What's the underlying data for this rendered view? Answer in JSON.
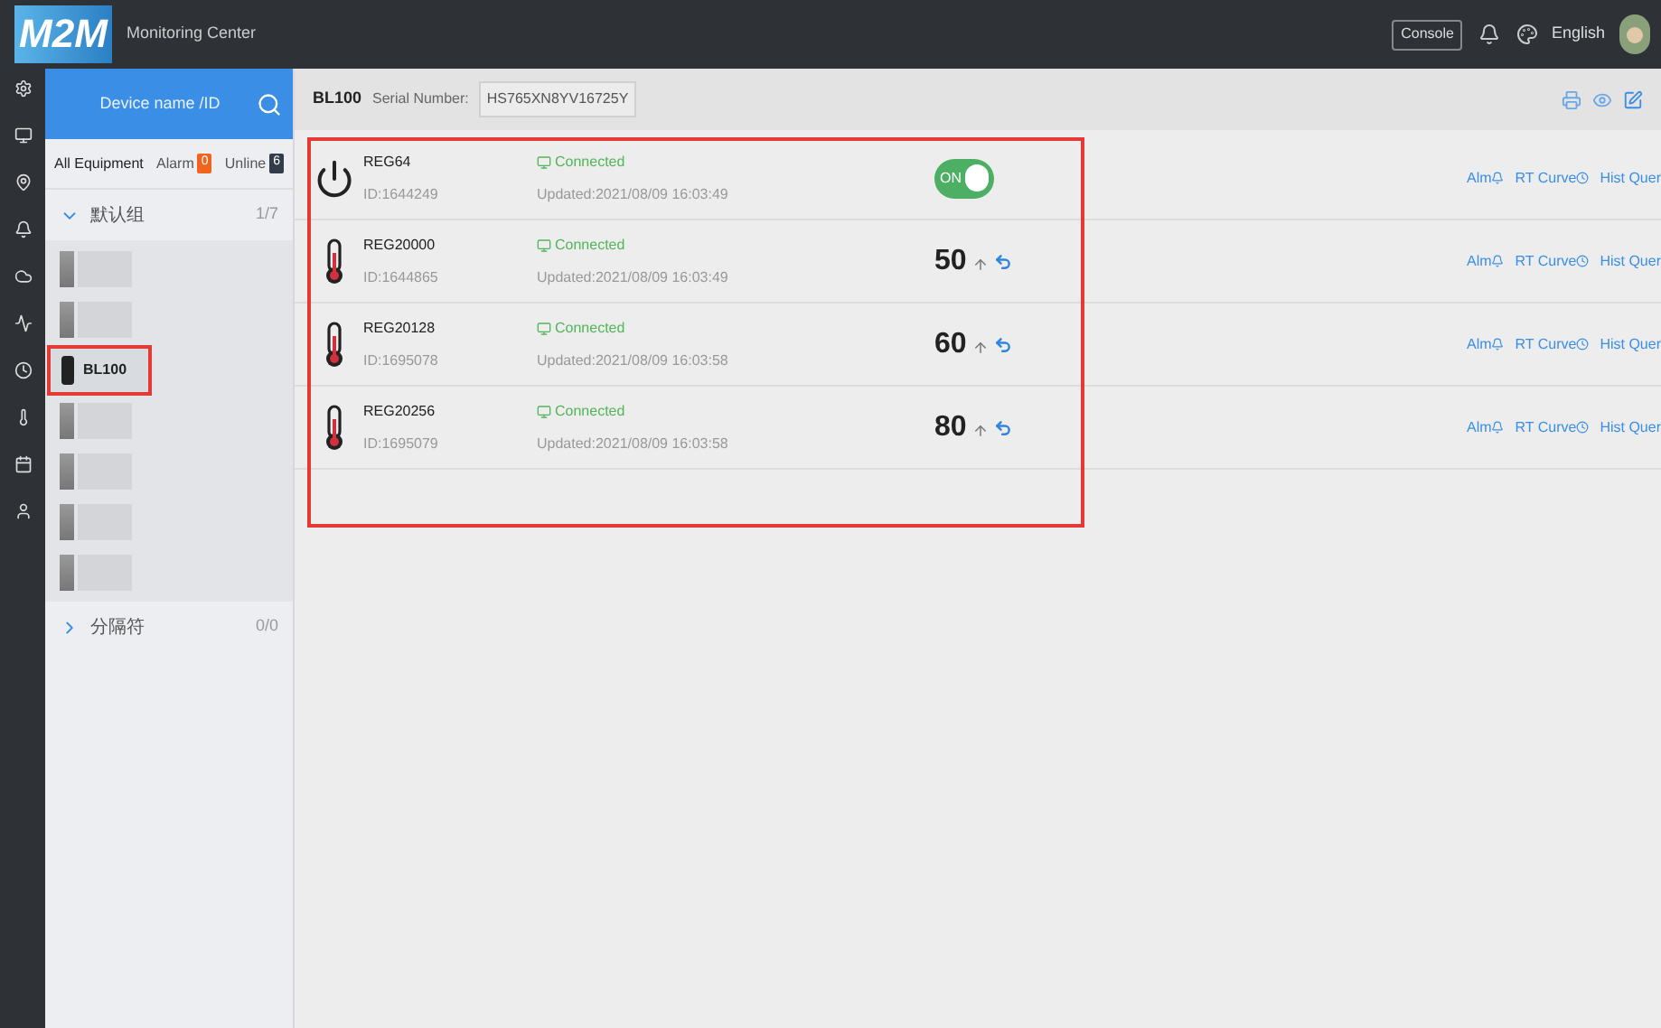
{
  "header": {
    "logo": "M2M",
    "title": "Monitoring Center",
    "console_button": "Console",
    "language": "English"
  },
  "device_panel": {
    "search": {
      "placeholder": "Device name /ID"
    },
    "tabs": [
      {
        "label": "All Equipment",
        "selected": true
      },
      {
        "label": "Alarm",
        "badge": "0",
        "color": "#f0641e",
        "selected": false
      },
      {
        "label": "Unline",
        "badge": "6",
        "color": "#333c4a",
        "selected": false
      }
    ],
    "groups": [
      {
        "label": "默认组",
        "count": "1/7",
        "expanded": true,
        "children": [
          {
            "kind": "blurred",
            "selected": false
          },
          {
            "kind": "blurred",
            "selected": false
          },
          {
            "kind": "device",
            "label": "BL100",
            "selected": true,
            "highlighted": true
          },
          {
            "kind": "blurred",
            "selected": false
          },
          {
            "kind": "blurred",
            "selected": false
          },
          {
            "kind": "blurred",
            "selected": false
          },
          {
            "kind": "blurred",
            "selected": false
          }
        ]
      },
      {
        "label": "分隔符",
        "count": "0/0",
        "expanded": false
      }
    ]
  },
  "toolbar": {
    "device": "BL100",
    "serial_label": "Serial Number:",
    "serial_value": "HS765XN8YV16725Y"
  },
  "registers": {
    "highlighted": true,
    "rows": [
      {
        "kind": "switch",
        "name": "REG64",
        "id": "ID:1644249",
        "status": "Connected",
        "updated": "Updated:2021/08/09 16:03:49",
        "on": true,
        "switch_label": "ON",
        "links": [
          "Alm",
          "RT Curve",
          "Hist Quer"
        ]
      },
      {
        "kind": "value",
        "name": "REG20000",
        "id": "ID:1644865",
        "status": "Connected",
        "updated": "Updated:2021/08/09 16:03:49",
        "value": "50",
        "links": [
          "Alm",
          "RT Curve",
          "Hist Quer"
        ]
      },
      {
        "kind": "value",
        "name": "REG20128",
        "id": "ID:1695078",
        "status": "Connected",
        "updated": "Updated:2021/08/09 16:03:58",
        "value": "60",
        "links": [
          "Alm",
          "RT Curve",
          "Hist Quer"
        ]
      },
      {
        "kind": "value",
        "name": "REG20256",
        "id": "ID:1695079",
        "status": "Connected",
        "updated": "Updated:2021/08/09 16:03:58",
        "value": "80",
        "links": [
          "Alm",
          "RT Curve",
          "Hist Quer"
        ]
      }
    ]
  }
}
